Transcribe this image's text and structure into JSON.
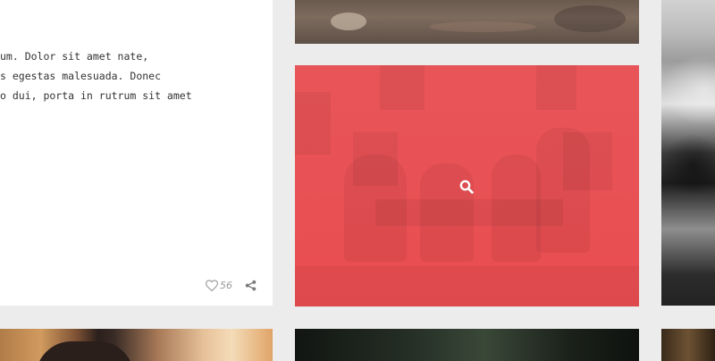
{
  "post": {
    "excerpt_lines": [
      "um. Dolor sit amet nate,",
      "s egestas malesuada. Donec",
      "o dui, porta in rutrum sit amet"
    ],
    "likes": "56",
    "like_icon": "heart-outline-icon",
    "share_icon": "share-icon"
  },
  "featured": {
    "overlay_color": "#e84d51",
    "zoom_icon": "search-icon"
  },
  "colors": {
    "page_background": "#ececec",
    "card_background": "#ffffff",
    "text": "#333333",
    "meta_text": "#9a9a9a"
  }
}
